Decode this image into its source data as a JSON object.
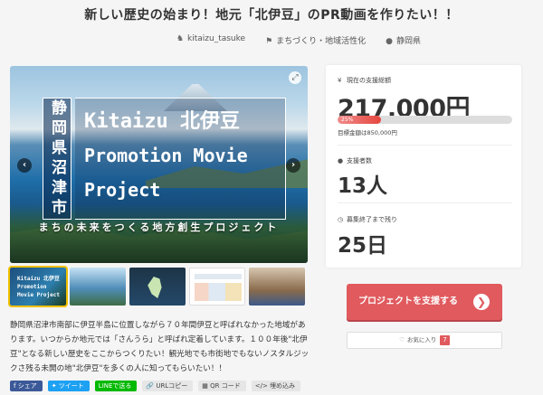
{
  "project": {
    "title": "新しい歴史の始まり！地元「北伊豆」のPR動画を作りたい！！",
    "owner": "kitaizu_tasuke",
    "category": "まちづくり・地域活性化",
    "location": "静岡県",
    "icons": {
      "owner": "user-icon",
      "category": "tag-icon",
      "location": "location-pin-icon"
    }
  },
  "hero": {
    "vertical_text": "静岡県沼津市",
    "line1": "Kitaizu 北伊豆",
    "line2": "Promotion Movie",
    "line3": "Project",
    "tagline": "まちの未来をつくる地方創生プロジェクト",
    "prev": "‹",
    "next": "›",
    "zoom": "⤢"
  },
  "thumbnails": [
    {
      "label": "Kitaizu 北伊豆 Promotion Movie Project",
      "active": true
    },
    {
      "label": "",
      "active": false
    },
    {
      "label": "",
      "active": false
    },
    {
      "label": "",
      "active": false
    },
    {
      "label": "",
      "active": false
    }
  ],
  "description": "静岡県沼津市南部に伊豆半島に位置しながら７０年間伊豆と呼ばれなかった地域があります。いつからか地元では「さんうら」と呼ばれ定着しています。１００年後\"北伊豆\"となる新しい歴史をここからつくりたい！観光地でも市街地でもないノスタルジックさ残る未開の地\"北伊豆\"を多くの人に知ってもらいたい！！",
  "share": {
    "facebook": "シェア",
    "twitter": "ツイート",
    "line": "LINEで送る",
    "url_copy": "URLコピー",
    "qr": "QR コード",
    "embed": "埋め込み"
  },
  "stats": {
    "current_label": "現在の支援総額",
    "current_amount": "217,000円",
    "progress_percent": 25,
    "progress_text": "25%",
    "goal_text": "目標金額は850,000円",
    "supporters_label": "支援者数",
    "supporters": "13人",
    "remaining_label": "募集終了まで残り",
    "remaining": "25日",
    "icons": {
      "current": "yen-icon",
      "supporters": "person-icon",
      "remaining": "clock-icon"
    }
  },
  "actions": {
    "support_label": "プロジェクトを支援する",
    "favorite_label": "お気に入り",
    "favorite_count": "7"
  },
  "colors": {
    "accent": "#e05a5e"
  }
}
